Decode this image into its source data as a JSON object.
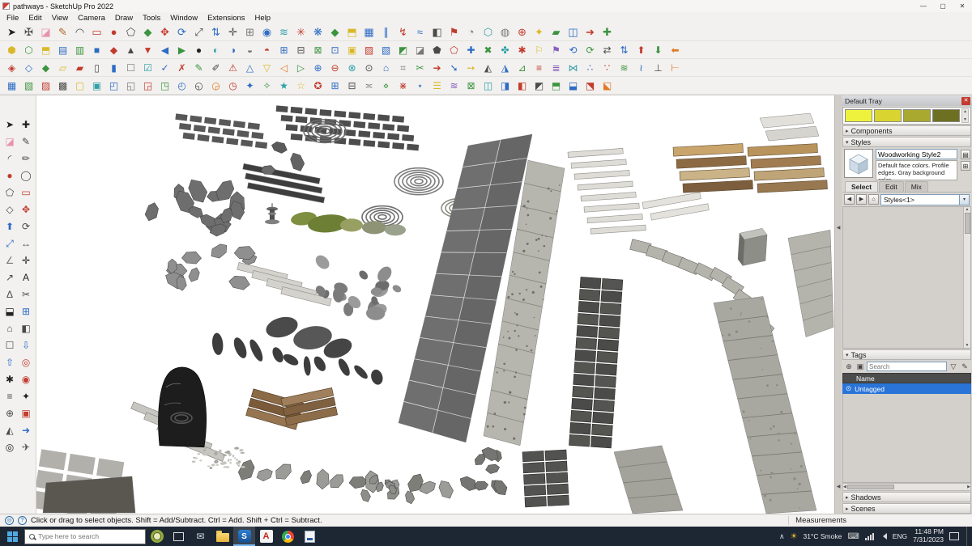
{
  "window": {
    "title": "pathways - SketchUp Pro 2022",
    "controls": {
      "minimize": "—",
      "maximize": "▢",
      "close": "✕"
    }
  },
  "menu": {
    "items": [
      "File",
      "Edit",
      "View",
      "Camera",
      "Draw",
      "Tools",
      "Window",
      "Extensions",
      "Help"
    ]
  },
  "icon_palette": {
    "r": "#c23b2e",
    "b": "#2d6bc4",
    "g": "#3d9440",
    "y": "#d9b92a",
    "k": "#4a4a4a",
    "o": "#e07b28",
    "t": "#2fa0a8",
    "p": "#e694ad",
    "w": "#8a8a8a",
    "d": "#222222",
    "m": "#8a5fc0",
    "n": "#1a4f8a",
    "l": "#9ccf3a",
    "s": "#777777",
    "e": "#b0672a",
    "c": "#7ec8e8"
  },
  "toolbars": {
    "rows": [
      {
        "glyphs": "➤✠◪✎◠▭●⬠◆✥⟳⤢⇅✛⊞◉≋✳❋◆⬒▦∥↯≈◧⚑◔⬡◍⊕✦▰◫➜✚",
        "colors": "dkpekrrkgrbkbksbtrbgybbrbkrstsrygbrg"
      },
      {
        "glyphs": "⬢⬡⬒▤▥■◆▲▼◀▶●◐◑◒◓⊞⊟⊠⊡▣▨▧◩◪⬟⬠✚✖✤✱⚐⚑⟲⟳⇄⇅⬆⬇⬅",
        "colors": "ygybgbrkrbgdtbsrbkgbyrbgskrbgtrymbgkbrgo"
      },
      {
        "glyphs": "◈◇◆▱▰▯▮☐☑✓✗✎✐⚠△▽◁▷⊕⊖⊗⊙⌂⌗✂➔➘➙◭◮⊿≡≣⋈∴∵≋≀⊥⊢",
        "colors": "rbgyrkbstbrgkrbyogbrtkbsgrbykbgrmtbrgbko"
      },
      {
        "glyphs": "▦▧▨▩▢▣◰◱◲◳◴◵◶◷✦✧★☆✪⊞⊟≍⋄⋇⋆☰≋⊠◫◨◧◩⬒⬓⬔⬕",
        "colors": "bgrkytbsrgbkorbgtyrbksgrbymgtbrkgbro"
      }
    ]
  },
  "left_toolbar": {
    "glyphs": "➤✚◪✎◜✏●◯⬠▭◇✥⬆⟳⤢↔∠✛↗AΔ✂⬓⊞⌂◧☐⇩⇧◎✱◉≡✦⊕▣◭➜◎✈",
    "colors": "ddpkkkrkkrkrbkbksdkdkkdbkkkbbrdrkdkrkbdk"
  },
  "glyphs": {
    "close": "✕",
    "expand": "▸",
    "collapse": "▾",
    "back": "◀",
    "fwd": "▶",
    "home": "⌂",
    "plus_circle": "⊕",
    "label": "▣",
    "filter": "▽",
    "pencil": "✎",
    "radio": "⊙",
    "up": "▲",
    "down": "▼",
    "left": "◀",
    "right": "▶",
    "hidden": "∧",
    "keyboard": "⌨",
    "detail": "▤",
    "new_style": "⊞"
  },
  "tray": {
    "title": "Default Tray",
    "swatches": [
      "#eef23d",
      "#d9d42f",
      "#a9a930",
      "#6e7021"
    ],
    "components_label": "Components",
    "styles_label": "Styles",
    "styles": {
      "name": "Woodworking Style2",
      "description": "Default face colors. Profile edges. Gray background color.",
      "tabs": [
        "Select",
        "Edit",
        "Mix"
      ],
      "dropdown_value": "Styles<1>"
    },
    "tags_label": "Tags",
    "tags": {
      "search_placeholder": "Search",
      "name_header": "Name",
      "rows": [
        {
          "label": "Untagged",
          "selected": true
        }
      ]
    },
    "shadows_label": "Shadows",
    "scenes_label": "Scenes"
  },
  "statusbar": {
    "icon_geo": "◎",
    "icon_help": "?",
    "hint": "Click or drag to select objects. Shift = Add/Subtract. Ctrl = Add. Shift + Ctrl = Subtract.",
    "measurements_label": "Measurements"
  },
  "taskbar": {
    "search_placeholder": "Type here to search",
    "app_glyphs": {
      "mail": "✉",
      "sketchup": "S",
      "autocad": "A"
    },
    "weather": "31°C Smoke",
    "language": "ENG",
    "time": "11:48 PM",
    "date": "7/31/2023"
  }
}
